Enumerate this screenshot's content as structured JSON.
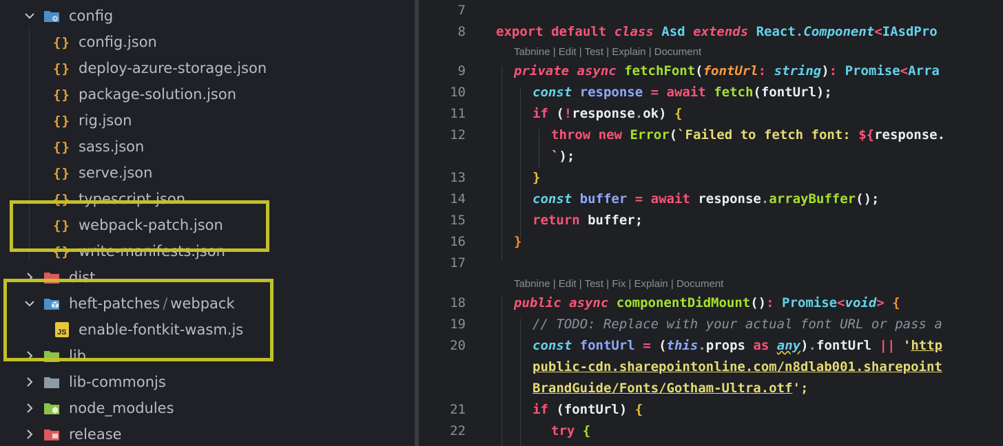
{
  "explorer": {
    "items": [
      {
        "kind": "folder-open",
        "label": "config",
        "icon": "config-folder-icon"
      },
      {
        "kind": "file",
        "label": "config.json",
        "icon": "json-icon"
      },
      {
        "kind": "file",
        "label": "deploy-azure-storage.json",
        "icon": "json-icon"
      },
      {
        "kind": "file",
        "label": "package-solution.json",
        "icon": "json-icon"
      },
      {
        "kind": "file",
        "label": "rig.json",
        "icon": "json-icon"
      },
      {
        "kind": "file",
        "label": "sass.json",
        "icon": "json-icon"
      },
      {
        "kind": "file",
        "label": "serve.json",
        "icon": "json-icon"
      },
      {
        "kind": "file",
        "label": "typescript.json",
        "icon": "json-icon"
      },
      {
        "kind": "file",
        "label": "webpack-patch.json",
        "icon": "json-icon"
      },
      {
        "kind": "file",
        "label": "write-manifests.json",
        "icon": "json-icon"
      },
      {
        "kind": "folder",
        "label": "dist",
        "icon": "dist-folder-icon"
      },
      {
        "kind": "folder-open",
        "label": "heft-patches",
        "label2": "webpack",
        "sep": "/",
        "icon": "package-folder-icon"
      },
      {
        "kind": "file",
        "label": "enable-fontkit-wasm.js",
        "icon": "js-icon"
      },
      {
        "kind": "folder",
        "label": "lib",
        "icon": "lib-folder-icon"
      },
      {
        "kind": "folder",
        "label": "lib-commonjs",
        "icon": "folder-icon"
      },
      {
        "kind": "folder",
        "label": "node_modules",
        "icon": "node-folder-icon"
      },
      {
        "kind": "folder",
        "label": "release",
        "icon": "release-folder-icon"
      }
    ],
    "json_glyph": "{}",
    "js_glyph": "JS",
    "highlight_color": "#c2c02a"
  },
  "editor": {
    "lens1": "Tabnine | Edit | Test | Explain | Document",
    "lens2": "Tabnine | Edit | Test | Fix | Explain | Document",
    "line_numbers": [
      "7",
      "8",
      "9",
      "10",
      "11",
      "12",
      "13",
      "14",
      "15",
      "16",
      "17",
      "18",
      "19",
      "20",
      "21",
      "22"
    ],
    "tokens": {
      "export": "export",
      "default": "default",
      "class": "class",
      "asd": "Asd",
      "extends": "extends",
      "react": "React",
      "dot": ".",
      "component": "Component",
      "lt": "<",
      "iasdpro": "IAsdPro",
      "private": "private",
      "async": "async",
      "fetchFont": "fetchFont",
      "lparen": "(",
      "rparen": ")",
      "fontUrl": "fontUrl",
      "colon": ":",
      "string": "string",
      "promise": "Promise",
      "arra": "Arra",
      "const": "const",
      "response": "response",
      "eq": "=",
      "await": "await",
      "fetch": "fetch",
      "semi": ";",
      "if": "if",
      "bang": "!",
      "ok": "ok",
      "lbrace": "{",
      "rbrace": "}",
      "throw": "throw",
      "new": "new",
      "error": "Error",
      "tmpl_start": "`Failed to fetch font: ",
      "tmpl_open": "${",
      "response_dot": "response.",
      "tmpl_end": "`",
      "close_call": ");",
      "buffer": "buffer",
      "arrayBuffer": "arrayBuffer",
      "unit": "()",
      "return": "return",
      "public": "public",
      "componentDidMount": "componentDidMount",
      "void": "void",
      "gt": ">",
      "comment": "// TODO: Replace with your actual font URL or pass a",
      "this": "this",
      "props": "props",
      "as": "as",
      "any": "any",
      "or": "||",
      "quote": "'",
      "http": "http",
      "url2": "public-cdn.sharepointonline.com/n8dlab001.sharepoint",
      "url3": "BrandGuide/Fonts/Gotham-Ultra.otf",
      "url3_end": "';",
      "try": "try"
    }
  }
}
